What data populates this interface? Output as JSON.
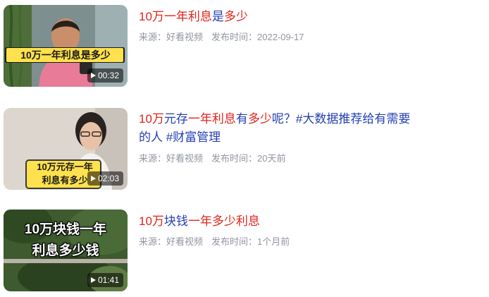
{
  "results": [
    {
      "title_parts": [
        {
          "text": "10万一年利息",
          "hl": true
        },
        {
          "text": "是",
          "hl": false
        },
        {
          "text": "多少",
          "hl": true
        }
      ],
      "thumb_caption": "10万一年利息是多少",
      "duration": "00:32",
      "source": "来源：好看视频",
      "publish": "发布时间：2022-09-17"
    },
    {
      "title_parts": [
        {
          "text": "10万",
          "hl": true
        },
        {
          "text": "元存",
          "hl": false
        },
        {
          "text": "一年利息",
          "hl": true
        },
        {
          "text": "有",
          "hl": false
        },
        {
          "text": "多少",
          "hl": true
        },
        {
          "text": "呢？#大数据推荐给有需要的人 #财富管理",
          "hl": false
        }
      ],
      "thumb_caption_lines": [
        "10万元存一年",
        "利息有多少"
      ],
      "duration": "02:03",
      "source": "来源：好看视频",
      "publish": "发布时间：20天前"
    },
    {
      "title_parts": [
        {
          "text": "10万",
          "hl": true
        },
        {
          "text": "块钱",
          "hl": false
        },
        {
          "text": "一年多少利息",
          "hl": true
        }
      ],
      "thumb_caption_lines": [
        "10万块钱一年",
        "利息多少钱"
      ],
      "duration": "01:41",
      "source": "来源：好看视频",
      "publish": "发布时间：1个月前"
    }
  ]
}
